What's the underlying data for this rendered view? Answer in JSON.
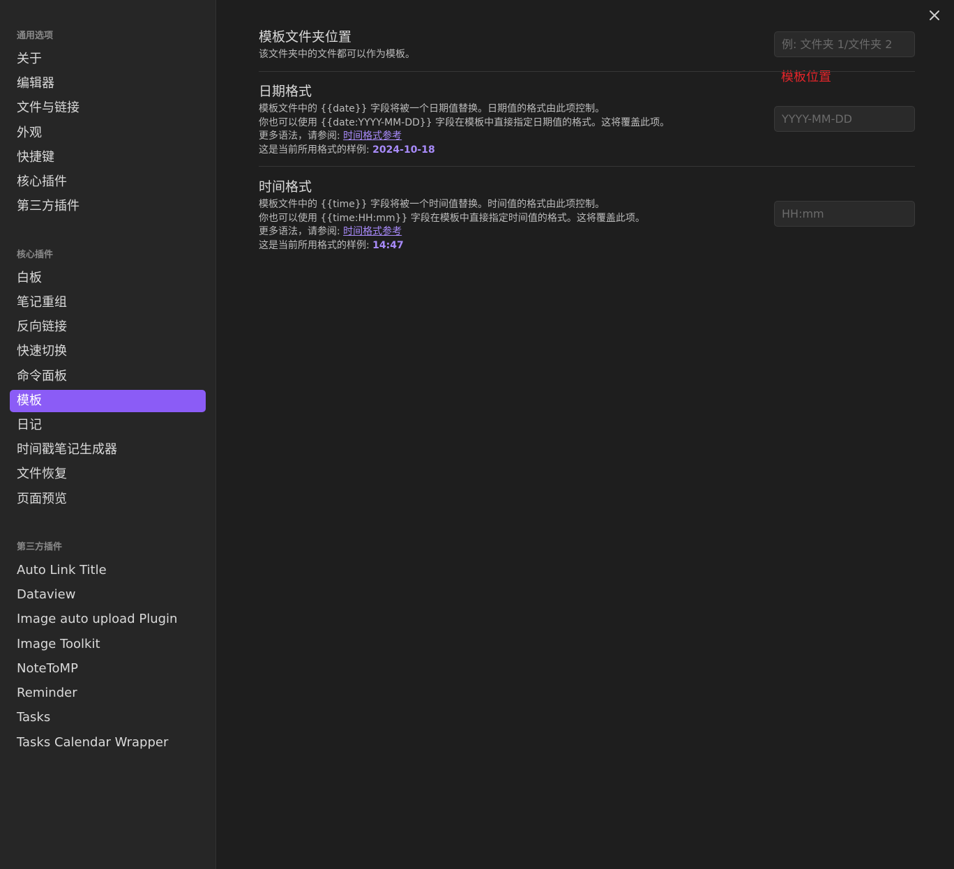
{
  "sidebar": {
    "general_heading": "通用选项",
    "general_items": [
      "关于",
      "编辑器",
      "文件与链接",
      "外观",
      "快捷键",
      "核心插件",
      "第三方插件"
    ],
    "core_heading": "核心插件",
    "core_items": [
      "白板",
      "笔记重组",
      "反向链接",
      "快速切换",
      "命令面板",
      "模板",
      "日记",
      "时间戳笔记生成器",
      "文件恢复",
      "页面预览"
    ],
    "core_active_index": 5,
    "community_heading": "第三方插件",
    "community_items": [
      "Auto Link Title",
      "Dataview",
      "Image auto upload Plugin",
      "Image Toolkit",
      "NoteToMP",
      "Reminder",
      "Tasks",
      "Tasks Calendar Wrapper"
    ]
  },
  "settings": {
    "folder": {
      "title": "模板文件夹位置",
      "desc": "该文件夹中的文件都可以作为模板。",
      "placeholder": "例: 文件夹 1/文件夹 2"
    },
    "date": {
      "title": "日期格式",
      "line1": "模板文件中的 {{date}} 字段将被一个日期值替换。日期值的格式由此项控制。",
      "line2": "你也可以使用 {{date:YYYY-MM-DD}} 字段在模板中直接指定日期值的格式。这将覆盖此项。",
      "more_prefix": "更多语法，请参阅: ",
      "link": "时间格式参考",
      "sample_prefix": "这是当前所用格式的样例: ",
      "sample": "2024-10-18",
      "placeholder": "YYYY-MM-DD"
    },
    "time": {
      "title": "时间格式",
      "line1": "模板文件中的 {{time}} 字段将被一个时间值替换。时间值的格式由此项控制。",
      "line2": "你也可以使用 {{time:HH:mm}} 字段在模板中直接指定时间值的格式。这将覆盖此项。",
      "more_prefix": "更多语法，请参阅: ",
      "link": "时间格式参考",
      "sample_prefix": "这是当前所用格式的样例: ",
      "sample": "14:47",
      "placeholder": "HH:mm"
    }
  },
  "annotation": "模板位置",
  "colors": {
    "accent": "#8b5cf6",
    "link": "#a88bfa",
    "annotation": "#e5252a",
    "background": "#1e1e1e",
    "sidebar": "#262626"
  },
  "icons": {
    "close": "close-icon"
  }
}
